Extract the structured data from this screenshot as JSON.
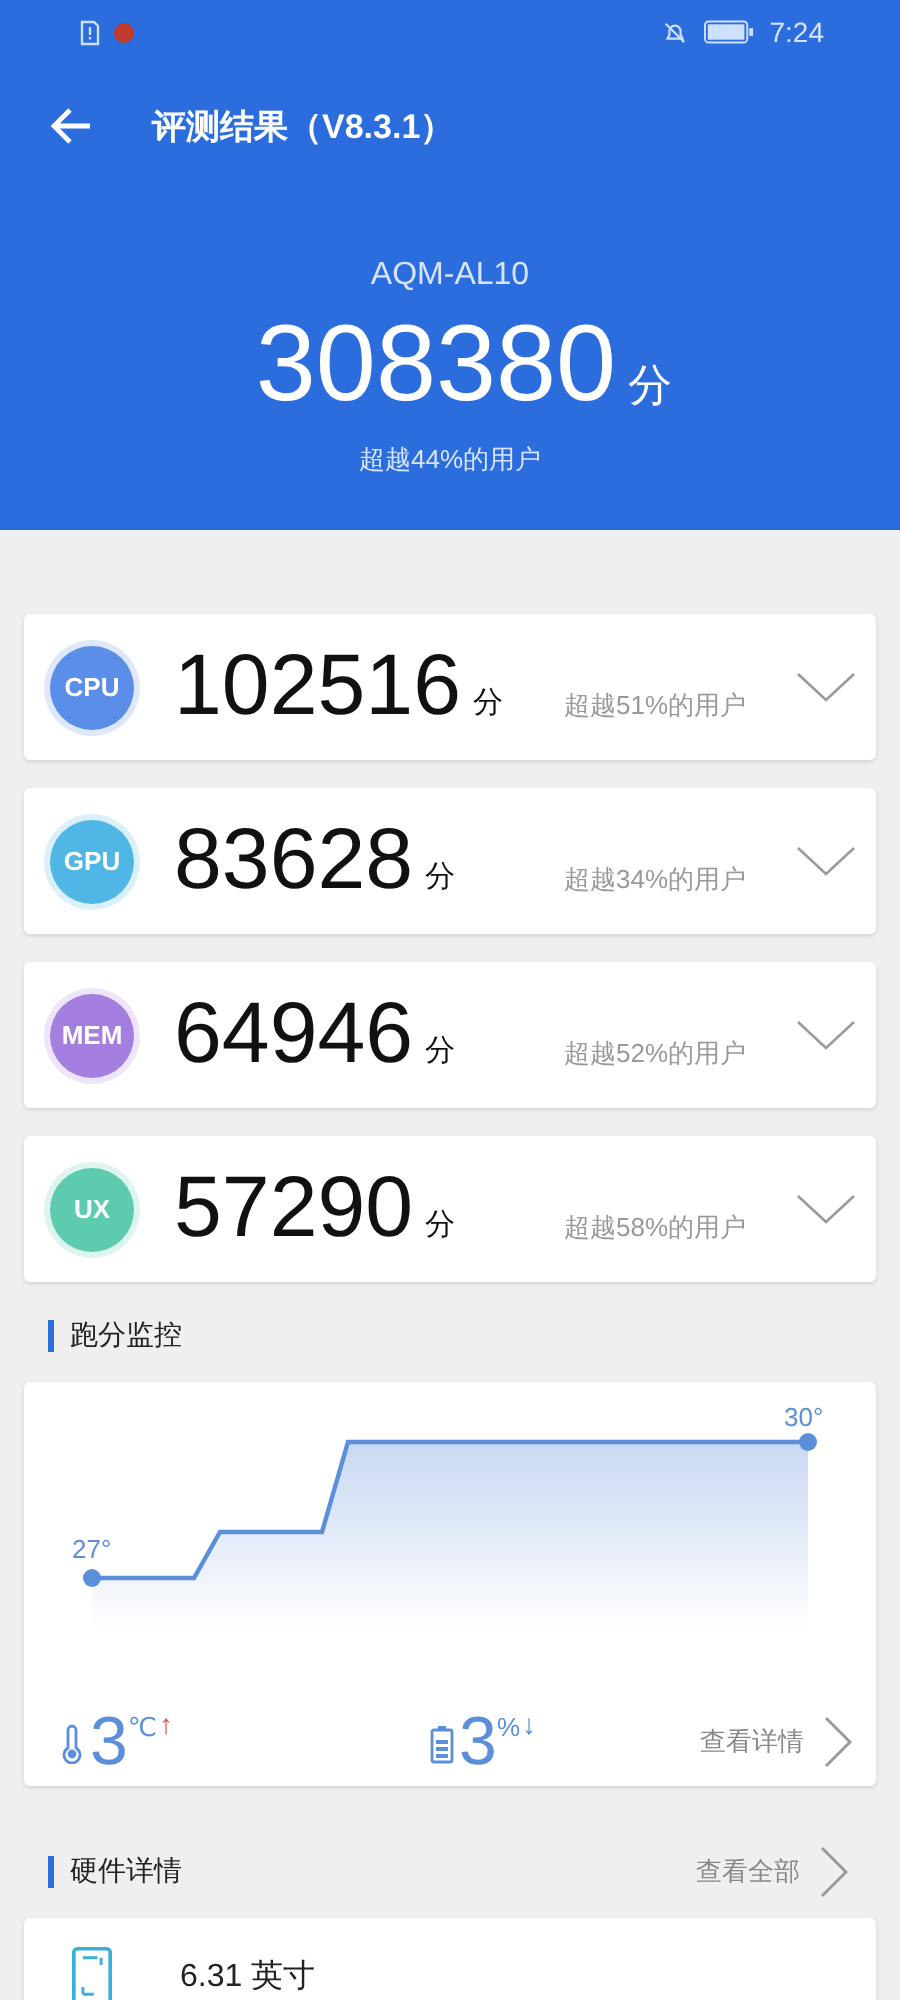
{
  "status_bar": {
    "time": "7:24"
  },
  "header": {
    "title": "评测结果（V8.3.1）",
    "device": "AQM-AL10",
    "score": "308380",
    "unit": "分",
    "rank": "超越44%的用户"
  },
  "categories": [
    {
      "badge": "CPU",
      "score": "102516",
      "unit": "分",
      "rank": "超越51%的用户",
      "color": "#5a8ee8",
      "expanded": false
    },
    {
      "badge": "GPU",
      "score": "83628",
      "unit": "分",
      "rank": "超越34%的用户",
      "color": "#4fb6e6",
      "expanded": false
    },
    {
      "badge": "MEM",
      "score": "64946",
      "unit": "分",
      "rank": "超越52%的用户",
      "color": "#a57fe0",
      "expanded": false
    },
    {
      "badge": "UX",
      "score": "57290",
      "unit": "分",
      "rank": "超越58%的用户",
      "color": "#5ccbb0",
      "expanded": false
    }
  ],
  "monitor": {
    "title": "跑分监控",
    "start_label": "27°",
    "end_label": "30°",
    "temp_value": "3",
    "temp_unit": "℃",
    "temp_arrow": "↑",
    "battery_value": "3",
    "battery_unit": "%",
    "battery_arrow": "↓",
    "link": "查看详情"
  },
  "hardware": {
    "title": "硬件详情",
    "link": "查看全部",
    "items": [
      {
        "label": "6.31 英寸"
      }
    ]
  }
}
